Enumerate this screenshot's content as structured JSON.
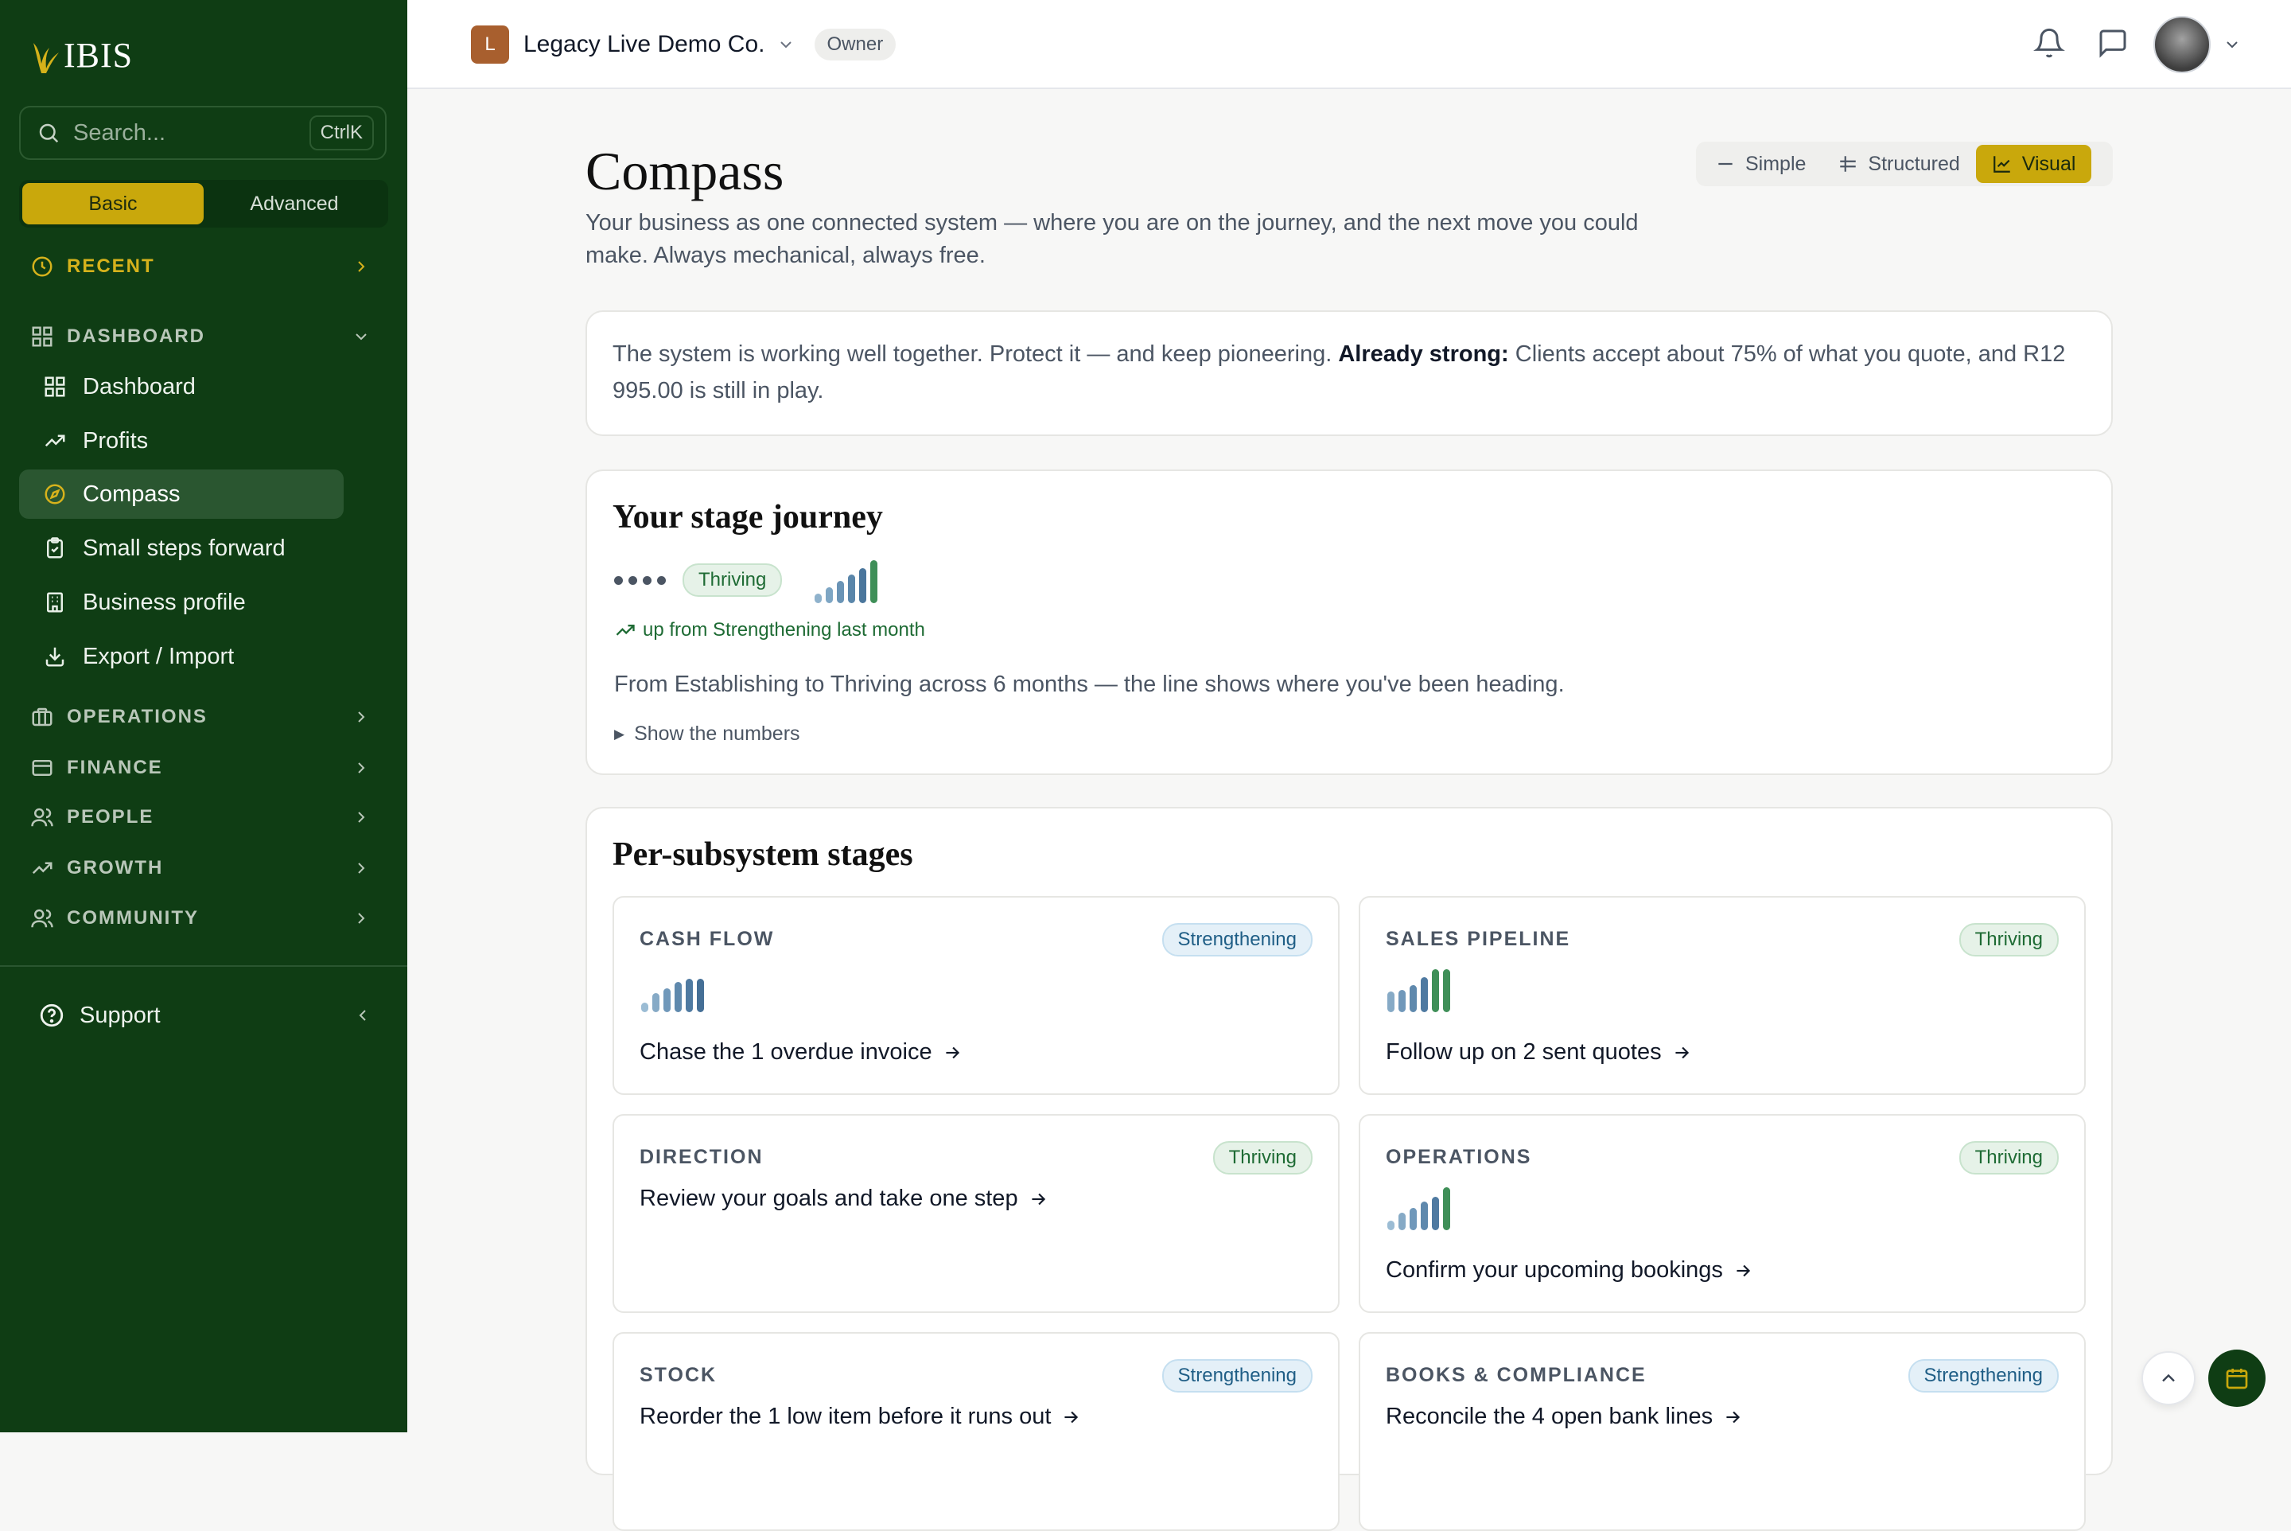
{
  "brand": {
    "name": "IBIS"
  },
  "sidebar": {
    "search_placeholder": "Search...",
    "search_shortcut": "CtrlK",
    "modes": [
      "Basic",
      "Advanced"
    ],
    "recent_label": "RECENT",
    "dashboard_label": "DASHBOARD",
    "dashboard_items": [
      {
        "label": "Dashboard",
        "icon": "grid-icon"
      },
      {
        "label": "Profits",
        "icon": "trend-up-icon"
      },
      {
        "label": "Compass",
        "icon": "compass-icon",
        "active": true
      },
      {
        "label": "Small steps forward",
        "icon": "clipboard-check-icon"
      },
      {
        "label": "Business profile",
        "icon": "building-icon"
      },
      {
        "label": "Export / Import",
        "icon": "download-icon"
      }
    ],
    "sections": [
      "OPERATIONS",
      "FINANCE",
      "PEOPLE",
      "GROWTH",
      "COMMUNITY"
    ],
    "support_label": "Support"
  },
  "topbar": {
    "company_initial": "L",
    "company_name": "Legacy Live Demo Co.",
    "role": "Owner"
  },
  "page": {
    "title": "Compass",
    "subtitle": "Your business as one connected system — where you are on the journey, and the next move you could make. Always mechanical, always free.",
    "view_modes": [
      "Simple",
      "Structured",
      "Visual"
    ],
    "active_view": "Visual"
  },
  "summary": {
    "lead": "The system is working well together. Protect it — and keep pioneering.",
    "strong_label": "Already strong:",
    "strong_text": "Clients accept about 75% of what you quote, and R12 995.00 is still in play."
  },
  "journey": {
    "title": "Your stage journey",
    "stage": "Thriving",
    "trend": "up from Strengthening last month",
    "description": "From Establishing to Thriving across 6 months — the line shows where you've been heading.",
    "toggle": "Show the numbers"
  },
  "subsystems": {
    "title": "Per-subsystem stages",
    "items": [
      {
        "label": "CASH FLOW",
        "stage": "Strengthening",
        "action": "Chase the 1 overdue invoice"
      },
      {
        "label": "SALES PIPELINE",
        "stage": "Thriving",
        "action": "Follow up on 2 sent quotes"
      },
      {
        "label": "DIRECTION",
        "stage": "Thriving",
        "action": "Review your goals and take one step"
      },
      {
        "label": "OPERATIONS",
        "stage": "Thriving",
        "action": "Confirm your upcoming bookings"
      },
      {
        "label": "STOCK",
        "stage": "Strengthening",
        "action": "Reorder the 1 low item before it runs out"
      },
      {
        "label": "BOOKS & COMPLIANCE",
        "stage": "Strengthening",
        "action": "Reconcile the 4 open bank lines"
      }
    ]
  },
  "colors": {
    "sidebar_bg": "#0f3d14",
    "accent_gold": "#c9a80c",
    "thriving_green": "#3f8f58",
    "strengthening_blue": "#4b7a9f"
  }
}
